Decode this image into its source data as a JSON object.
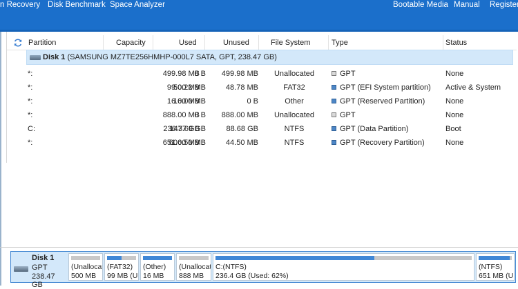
{
  "menu": {
    "data_recovery": "n Recovery",
    "disk_benchmark": "Disk Benchmark",
    "space_analyzer": "Space Analyzer",
    "bootable_media": "Bootable Media",
    "manual": "Manual",
    "register": "Register"
  },
  "icons": {
    "refresh": "refresh-icon",
    "disk": "disk-icon",
    "unallocated_type": "unallocated-square-icon",
    "partition_type": "partition-square-icon"
  },
  "columns": {
    "partition": "Partition",
    "capacity": "Capacity",
    "used": "Used",
    "unused": "Unused",
    "file_system": "File System",
    "type": "Type",
    "status": "Status"
  },
  "disk": {
    "name": "Disk 1",
    "details": "(SAMSUNG MZ7TE256HMHP-000L7 SATA, GPT, 238.47 GB)"
  },
  "partitions": [
    {
      "partition": "*:",
      "capacity": "499.98 MB",
      "used": "0 B",
      "unused": "499.98 MB",
      "file_system": "Unallocated",
      "type": "GPT",
      "status": "None",
      "allocated": false
    },
    {
      "partition": "*:",
      "capacity": "99.00 MB",
      "used": "50.22 MB",
      "unused": "48.78 MB",
      "file_system": "FAT32",
      "type": "GPT (EFI System partition)",
      "status": "Active & System",
      "allocated": true
    },
    {
      "partition": "*:",
      "capacity": "16.00 MB",
      "used": "16.00 MB",
      "unused": "0 B",
      "file_system": "Other",
      "type": "GPT (Reserved Partition)",
      "status": "None",
      "allocated": true
    },
    {
      "partition": "*:",
      "capacity": "888.00 MB",
      "used": "0 B",
      "unused": "888.00 MB",
      "file_system": "Unallocated",
      "type": "GPT",
      "status": "None",
      "allocated": false
    },
    {
      "partition": "C:",
      "capacity": "236.37 GB",
      "used": "147.69 GB",
      "unused": "88.68 GB",
      "file_system": "NTFS",
      "type": "GPT (Data Partition)",
      "status": "Boot",
      "allocated": true
    },
    {
      "partition": "*:",
      "capacity": "651.00 MB",
      "used": "606.50 MB",
      "unused": "44.50 MB",
      "file_system": "NTFS",
      "type": "GPT (Recovery Partition)",
      "status": "None",
      "allocated": true
    }
  ],
  "disk_map": {
    "name": "Disk 1",
    "type": "GPT",
    "size": "238.47 GB",
    "segments": [
      {
        "line1": "(Unallocat",
        "line2": "500 MB",
        "used_fraction": 0,
        "allocated": false
      },
      {
        "line1": "(FAT32)",
        "line2": "99 MB (Us",
        "used_fraction": 0.51,
        "allocated": true
      },
      {
        "line1": "(Other)",
        "line2": "16 MB",
        "used_fraction": 1.0,
        "allocated": true
      },
      {
        "line1": "(Unallocat",
        "line2": "888 MB",
        "used_fraction": 0,
        "allocated": false
      },
      {
        "line1": "C:(NTFS)",
        "line2": "236.4 GB (Used: 62%)",
        "used_fraction": 0.62,
        "allocated": true
      },
      {
        "line1": "(NTFS)",
        "line2": "651 MB (U",
        "used_fraction": 0.93,
        "allocated": true
      }
    ]
  },
  "colors": {
    "toolbar": "#1b6fcb",
    "selected_row": "#d3e8fa",
    "used_fill": "#3f87d6",
    "unallocated_fill": "#c8c8c8"
  }
}
